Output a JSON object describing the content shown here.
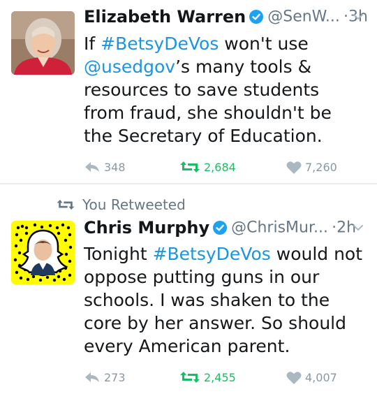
{
  "tweets": [
    {
      "name": "Elizabeth Warren",
      "handle": "@SenW...",
      "dot": "·",
      "time": "3h",
      "text_plain_1": "If ",
      "hashtag": "#BetsyDeVos",
      "text_plain_2": " won't use ",
      "mention": "@usedgov",
      "text_plain_3": "’s many tools & resources to save students from fraud, she shouldn't be the Secretary of Education.",
      "replies": "348",
      "retweets": "2,684",
      "likes": "7,260"
    },
    {
      "retweet_banner": "You Retweeted",
      "name": "Chris Murphy",
      "handle": "@ChrisMur...",
      "dot": "·",
      "time": "2h",
      "text_plain_1": "Tonight ",
      "hashtag": "#BetsyDeVos",
      "text_plain_2": " would not oppose putting guns in our schools. I was shaken to the core by her answer. So should every American parent.",
      "replies": "273",
      "retweets": "2,455",
      "likes": "4,007"
    }
  ],
  "colors": {
    "link": "#1b95e0",
    "retweet_green": "#17bf63",
    "muted": "#8899a6",
    "snapcode_yellow": "#fffc00"
  },
  "icons": [
    "verified-badge-icon",
    "chevron-down-icon",
    "reply-icon",
    "retweet-icon",
    "heart-icon"
  ]
}
